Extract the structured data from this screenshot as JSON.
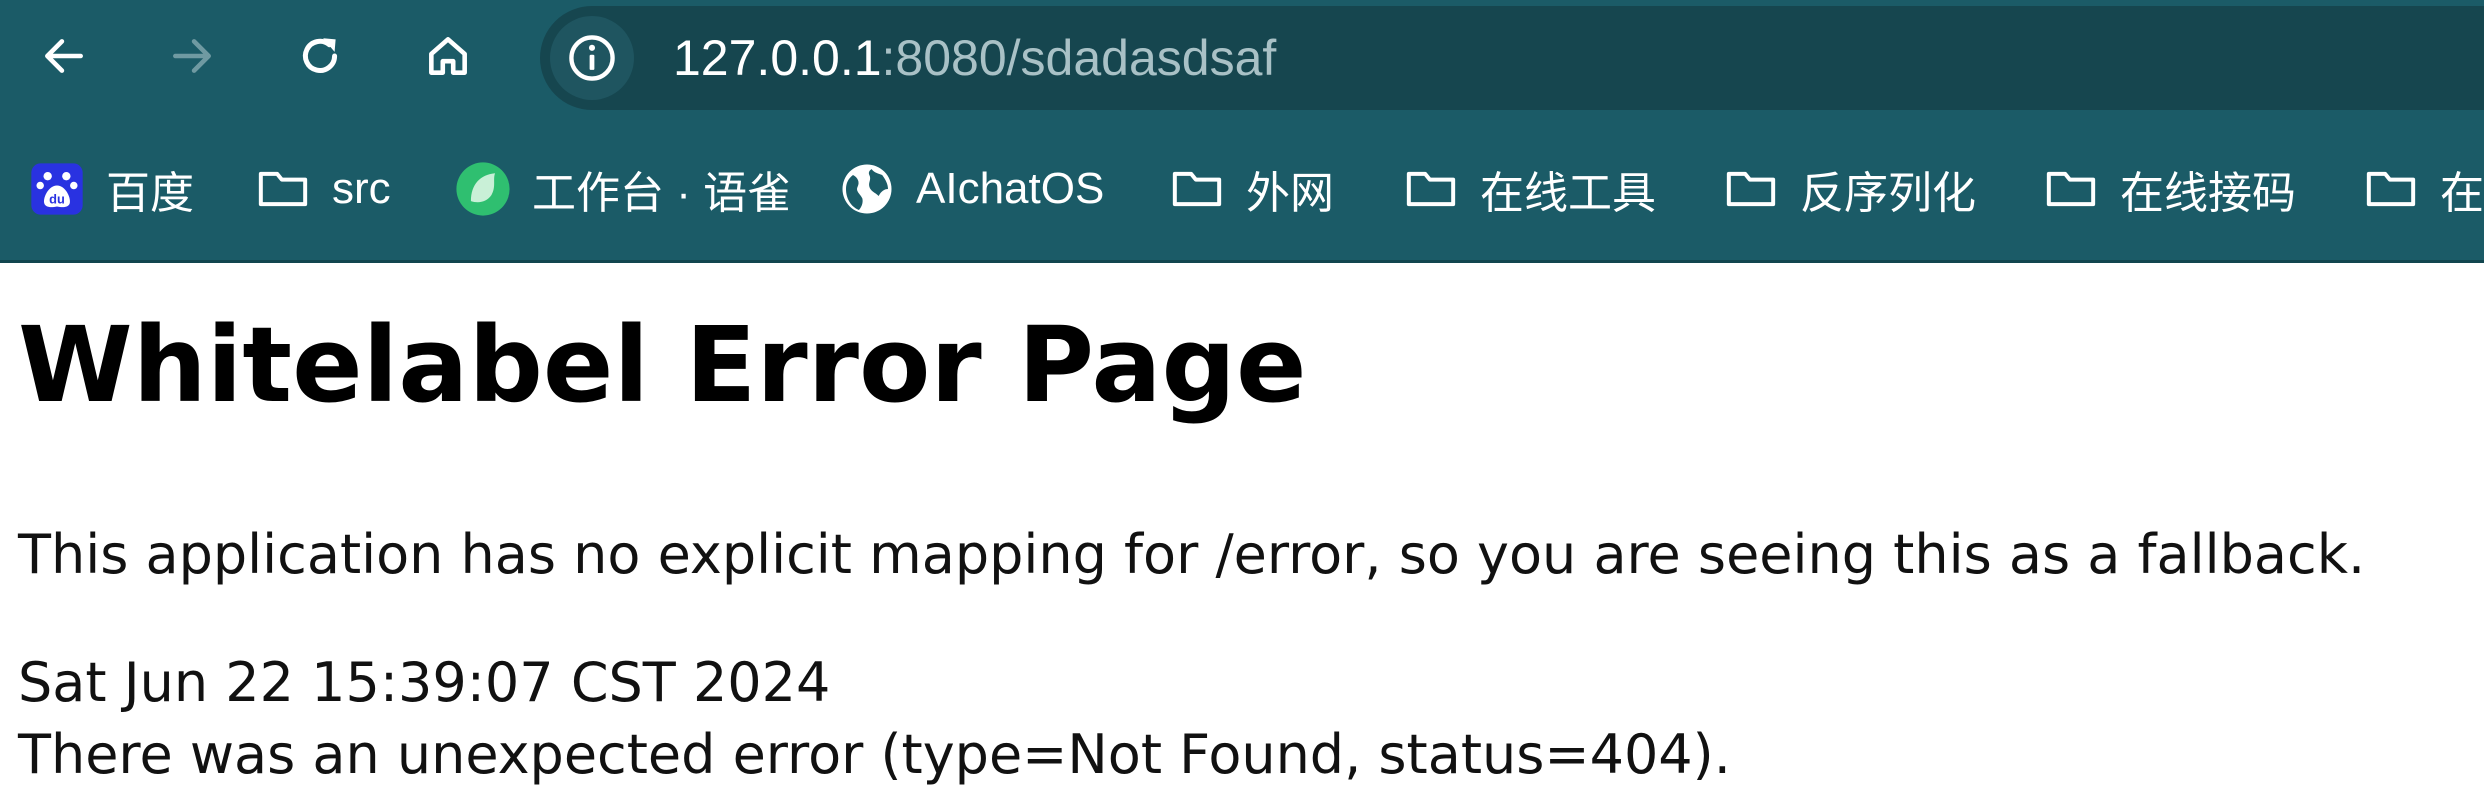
{
  "browser": {
    "toolbar": {
      "back_label": "Back",
      "forward_label": "Forward",
      "reload_label": "Reload",
      "home_label": "Home"
    },
    "address_bar": {
      "url_host": "127.0.0.1",
      "url_rest": ":8080/sdadasdsaf",
      "site_info_icon": "info-icon"
    },
    "bookmarks": [
      {
        "label": "百度",
        "icon": "baidu-icon"
      },
      {
        "label": "src",
        "icon": "folder-icon"
      },
      {
        "label": "工作台 · 语雀",
        "icon": "yuque-icon"
      },
      {
        "label": "AIchatOS",
        "icon": "globe-icon"
      },
      {
        "label": "外网",
        "icon": "folder-icon"
      },
      {
        "label": "在线工具",
        "icon": "folder-icon"
      },
      {
        "label": "反序列化",
        "icon": "folder-icon"
      },
      {
        "label": "在线接码",
        "icon": "folder-icon"
      },
      {
        "label": "在",
        "icon": "folder-icon"
      }
    ],
    "colors": {
      "chrome_bg": "#1b5b67",
      "omnibox_bg": "#16464f",
      "baidu_blue": "#2932e1",
      "yuque_green": "#2fbf70"
    }
  },
  "page": {
    "title": "Whitelabel Error Page",
    "description": "This application has no explicit mapping for /error, so you are seeing this as a fallback.",
    "timestamp": "Sat Jun 22 15:39:07 CST 2024",
    "error_message": "There was an unexpected error (type=Not Found, status=404)."
  }
}
